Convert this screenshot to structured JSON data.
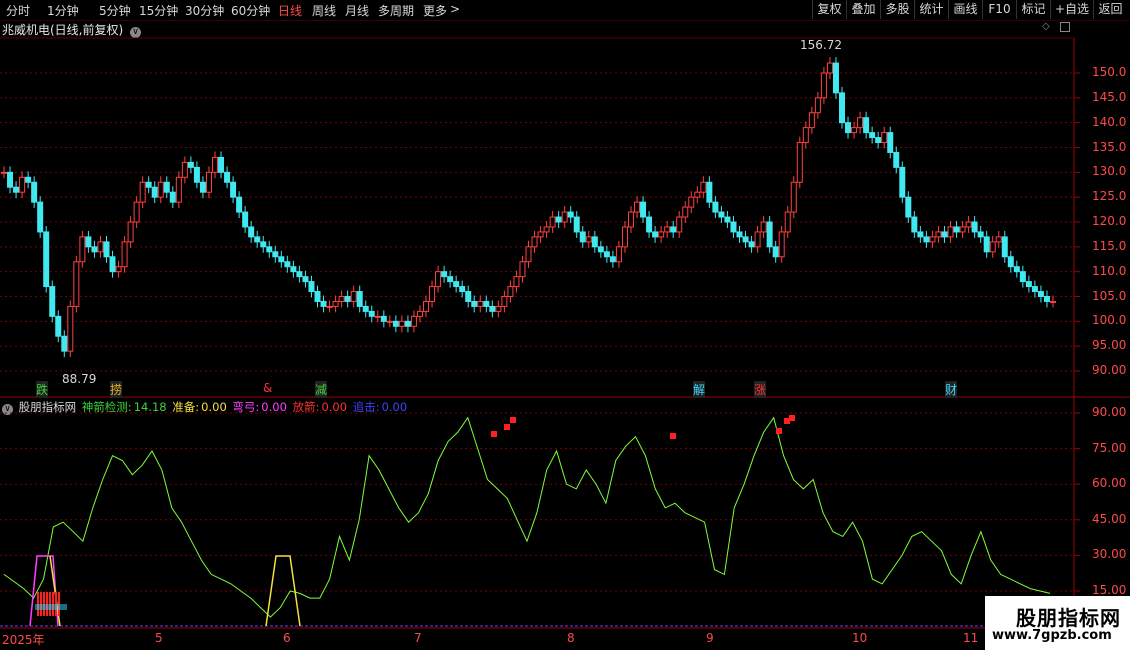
{
  "toolbar": {
    "periods": [
      "分时",
      "1分钟",
      "5分钟",
      "15分钟",
      "30分钟",
      "60分钟",
      "日线",
      "周线",
      "月线",
      "多周期",
      "更多"
    ],
    "active_period": "日线",
    "right_buttons": [
      "复权",
      "叠加",
      "多股",
      "统计",
      "画线",
      "F10",
      "标记",
      "+自选",
      "返回"
    ]
  },
  "main_chart": {
    "title": "兆威机电(日线,前复权)",
    "high_label": "156.72",
    "low_label": "88.79",
    "y_ticks": [
      "150.0",
      "145.0",
      "140.0",
      "135.0",
      "130.0",
      "125.0",
      "120.0",
      "115.0",
      "110.0",
      "105.0",
      "100.0",
      "95.00",
      "90.00"
    ],
    "markers": [
      {
        "text": "跌",
        "color": "#3ad23a"
      },
      {
        "text": "捞",
        "color": "#e0b020"
      },
      {
        "text": "&",
        "color": "#ff3030"
      },
      {
        "text": "减",
        "color": "#3ad23a"
      },
      {
        "text": "解",
        "color": "#3ad9ff"
      },
      {
        "text": "涨",
        "color": "#ff3030"
      },
      {
        "text": "财",
        "color": "#3ad9ff"
      }
    ]
  },
  "indicator": {
    "name": "股朋指标网",
    "items": [
      {
        "label": "神箭检测:",
        "value": "14.18",
        "color": "#3ad23a"
      },
      {
        "label": "准备:",
        "value": "0.00",
        "color": "#f0e040"
      },
      {
        "label": "弯弓:",
        "value": "0.00",
        "color": "#ff40ff"
      },
      {
        "label": "放箭:",
        "value": "0.00",
        "color": "#ff3030"
      },
      {
        "label": "追击:",
        "value": "0.00",
        "color": "#4040ff"
      }
    ],
    "y_ticks": [
      "90.00",
      "75.00",
      "60.00",
      "45.00",
      "30.00",
      "15.00"
    ]
  },
  "x_axis": [
    "2025年",
    "5",
    "6",
    "7",
    "8",
    "9",
    "10",
    "11"
  ],
  "watermark": {
    "line1": "股朋指标网",
    "line2": "www.7gpzb.com"
  },
  "colors": {
    "up": "#ff4040",
    "down": "#40e8f0",
    "grid": "#8b0000",
    "line": "#7cff3c"
  }
}
